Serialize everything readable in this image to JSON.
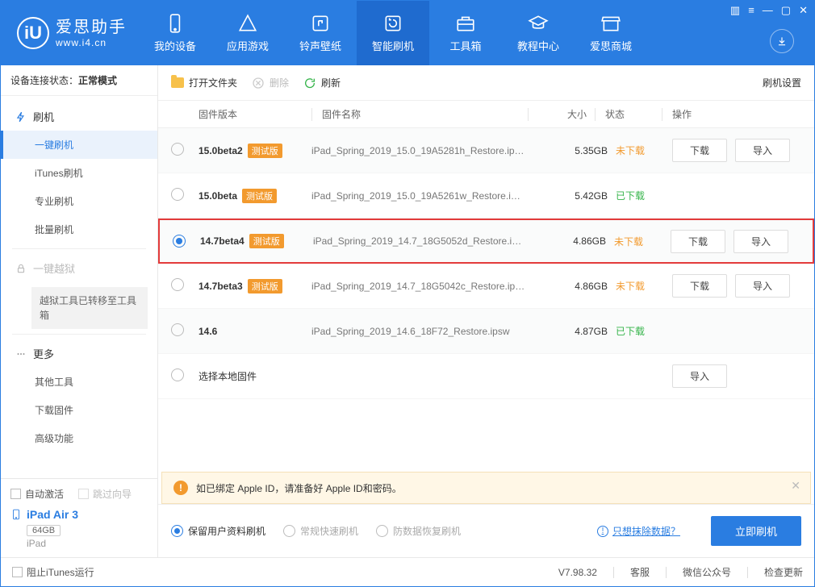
{
  "branding": {
    "title": "爱思助手",
    "site": "www.i4.cn"
  },
  "nav": [
    {
      "label": "我的设备"
    },
    {
      "label": "应用游戏"
    },
    {
      "label": "铃声壁纸"
    },
    {
      "label": "智能刷机"
    },
    {
      "label": "工具箱"
    },
    {
      "label": "教程中心"
    },
    {
      "label": "爱思商城"
    }
  ],
  "sidebar": {
    "device_status_label": "设备连接状态：",
    "device_status_value": "正常模式",
    "flash_header": "刷机",
    "flash_items": [
      "一键刷机",
      "iTunes刷机",
      "专业刷机",
      "批量刷机"
    ],
    "jailbreak_header": "一键越狱",
    "jailbreak_note": "越狱工具已转移至工具箱",
    "more_header": "更多",
    "more_items": [
      "其他工具",
      "下载固件",
      "高级功能"
    ],
    "auto_activate": "自动激活",
    "skip_guide": "跳过向导",
    "device_name": "iPad Air 3",
    "device_storage": "64GB",
    "device_model": "iPad"
  },
  "toolbar": {
    "open_folder": "打开文件夹",
    "delete": "删除",
    "refresh": "刷新",
    "settings": "刷机设置"
  },
  "table": {
    "headers": {
      "version": "固件版本",
      "name": "固件名称",
      "size": "大小",
      "status": "状态",
      "actions": "操作"
    },
    "beta_badge": "测试版",
    "download_btn": "下载",
    "import_btn": "导入",
    "local_label": "选择本地固件",
    "rows": [
      {
        "version": "15.0beta2",
        "beta": true,
        "name": "iPad_Spring_2019_15.0_19A5281h_Restore.ip…",
        "size": "5.35GB",
        "status": "未下载",
        "status_cls": "st-not",
        "selected": false,
        "alt": true,
        "actions": [
          "download",
          "import"
        ]
      },
      {
        "version": "15.0beta",
        "beta": true,
        "name": "iPad_Spring_2019_15.0_19A5261w_Restore.i…",
        "size": "5.42GB",
        "status": "已下载",
        "status_cls": "st-done",
        "selected": false,
        "alt": false,
        "actions": []
      },
      {
        "version": "14.7beta4",
        "beta": true,
        "name": "iPad_Spring_2019_14.7_18G5052d_Restore.i…",
        "size": "4.86GB",
        "status": "未下载",
        "status_cls": "st-not",
        "selected": true,
        "alt": true,
        "actions": [
          "download",
          "import"
        ],
        "highlight": true
      },
      {
        "version": "14.7beta3",
        "beta": true,
        "name": "iPad_Spring_2019_14.7_18G5042c_Restore.ip…",
        "size": "4.86GB",
        "status": "未下载",
        "status_cls": "st-not",
        "selected": false,
        "alt": false,
        "actions": [
          "download",
          "import"
        ]
      },
      {
        "version": "14.6",
        "beta": false,
        "name": "iPad_Spring_2019_14.6_18F72_Restore.ipsw",
        "size": "4.87GB",
        "status": "已下载",
        "status_cls": "st-done",
        "selected": false,
        "alt": true,
        "actions": []
      }
    ]
  },
  "notice": "如已绑定 Apple ID，请准备好 Apple ID和密码。",
  "options": {
    "keep_data": "保留用户资料刷机",
    "normal": "常规快速刷机",
    "antirecover": "防数据恢复刷机",
    "wipe_link": "只想抹除数据？",
    "flash_now": "立即刷机"
  },
  "footer": {
    "block_itunes": "阻止iTunes运行",
    "version": "V7.98.32",
    "support": "客服",
    "wechat": "微信公众号",
    "check_update": "检查更新"
  }
}
